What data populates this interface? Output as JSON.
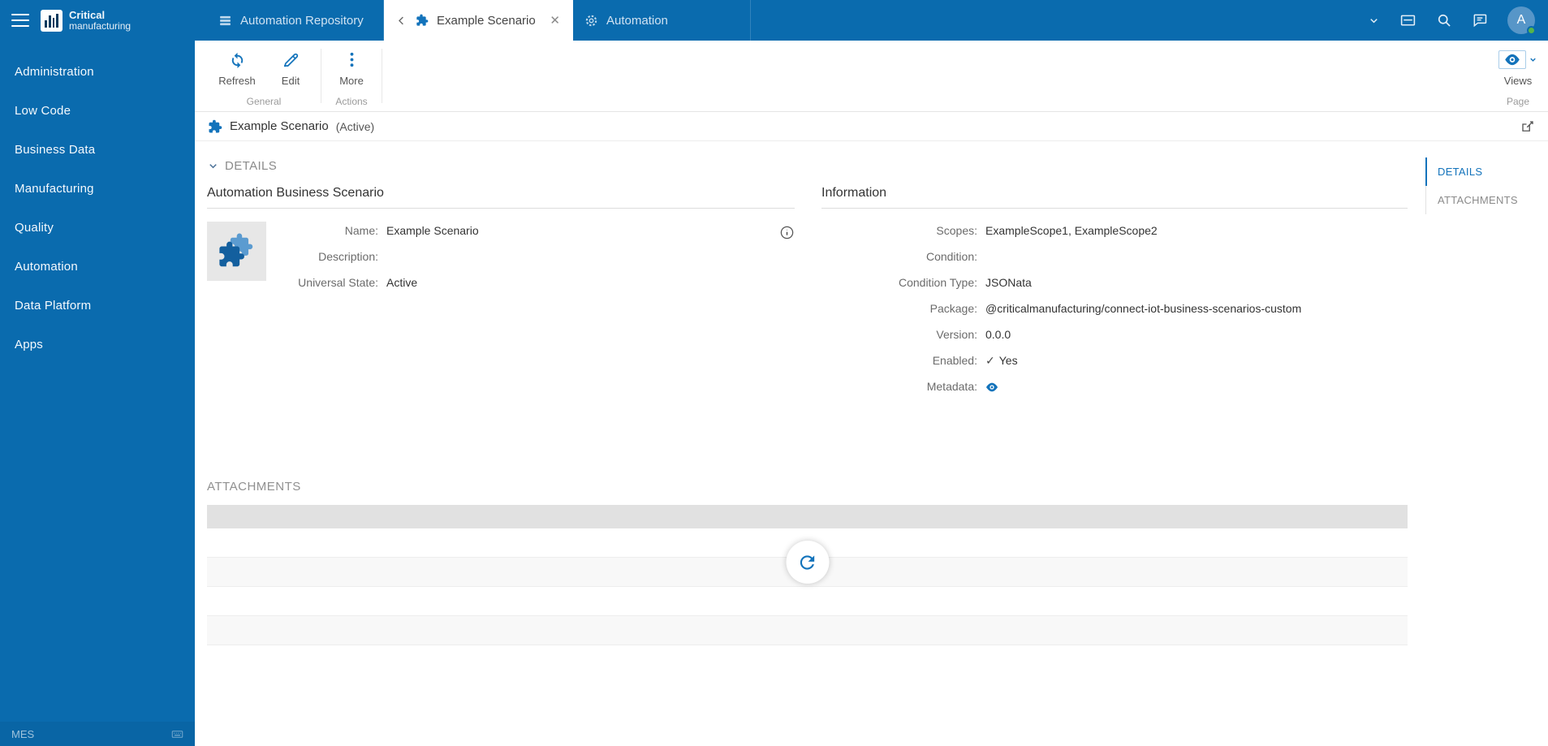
{
  "colors": {
    "primary": "#0a6bae",
    "accent": "#1373bb"
  },
  "brand": {
    "bold": "Critical",
    "light": "manufacturing"
  },
  "sidebar": {
    "items": [
      {
        "label": "Administration"
      },
      {
        "label": "Low Code"
      },
      {
        "label": "Business Data"
      },
      {
        "label": "Manufacturing"
      },
      {
        "label": "Quality"
      },
      {
        "label": "Automation"
      },
      {
        "label": "Data Platform"
      },
      {
        "label": "Apps"
      }
    ],
    "footer": {
      "left": "MES"
    }
  },
  "topbar": {
    "tabs": [
      {
        "label": "Automation Repository"
      },
      {
        "label": "Example Scenario"
      },
      {
        "label": "Automation"
      }
    ],
    "avatar_initial": "A"
  },
  "ribbon": {
    "buttons": {
      "refresh": "Refresh",
      "edit": "Edit",
      "more": "More",
      "views": "Views"
    },
    "groups": {
      "general": "General",
      "actions": "Actions",
      "page": "Page"
    }
  },
  "entity": {
    "title": "Example Scenario",
    "state": "(Active)"
  },
  "details": {
    "title": "DETAILS",
    "left": {
      "title": "Automation Business Scenario",
      "fields": [
        {
          "label": "Name:",
          "value": "Example Scenario"
        },
        {
          "label": "Description:",
          "value": ""
        },
        {
          "label": "Universal State:",
          "value": "Active"
        }
      ]
    },
    "right": {
      "title": "Information",
      "fields": [
        {
          "label": "Scopes:",
          "value": "ExampleScope1, ExampleScope2"
        },
        {
          "label": "Condition:",
          "value": ""
        },
        {
          "label": "Condition Type:",
          "value": "JSONata"
        },
        {
          "label": "Package:",
          "value": "@criticalmanufacturing/connect-iot-business-scenarios-custom"
        },
        {
          "label": "Version:",
          "value": "0.0.0"
        },
        {
          "label": "Enabled:",
          "value": "Yes"
        },
        {
          "label": "Metadata:",
          "value": ""
        }
      ]
    }
  },
  "side_tabs": [
    {
      "label": "DETAILS"
    },
    {
      "label": "ATTACHMENTS"
    }
  ],
  "attachments": {
    "title": "ATTACHMENTS"
  }
}
